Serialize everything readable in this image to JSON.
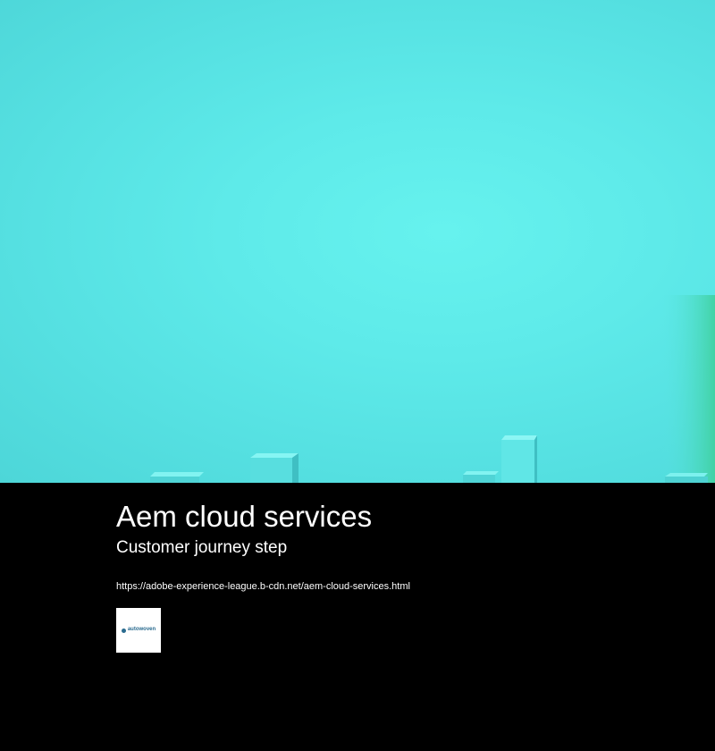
{
  "hero": {
    "background_color": "#5eeae9",
    "accent_color": "#3ecf9a"
  },
  "article": {
    "title": "Aem cloud services",
    "subtitle": "Customer journey step",
    "url": "https://adobe-experience-league.b-cdn.net/aem-cloud-services.html"
  },
  "logo": {
    "name": "autowoven",
    "icon": "autowoven-logo"
  }
}
